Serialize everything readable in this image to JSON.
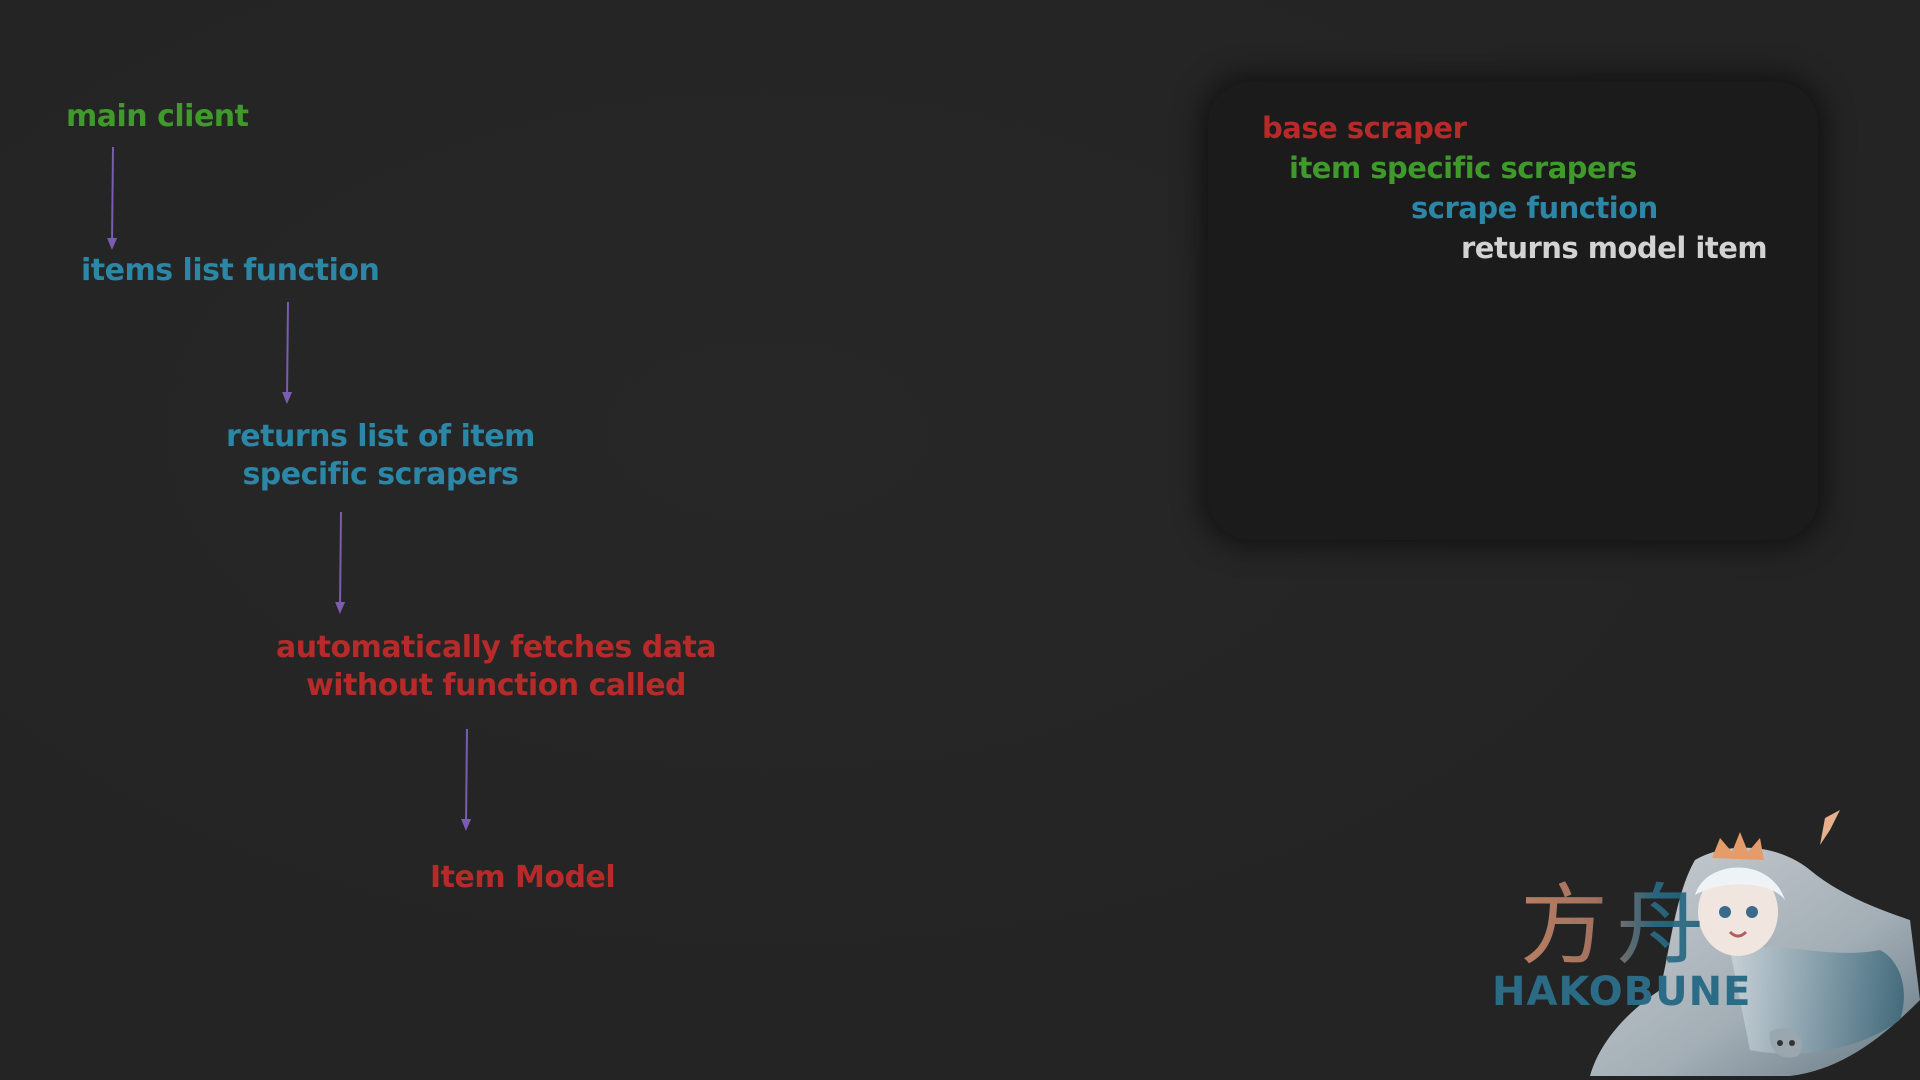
{
  "flow": {
    "main_client": "main client",
    "items_list_function": "items list function",
    "returns_list": [
      "returns list of item",
      "specific scrapers"
    ],
    "auto_fetch": [
      "automatically fetches data",
      "without function called"
    ],
    "item_model": "Item Model"
  },
  "legend": {
    "base_scraper": "base scraper",
    "item_specific_scrapers": "item specific scrapers",
    "scrape_function": "scrape function",
    "returns_model_item": "returns model item"
  },
  "brand": {
    "kanji": "方舟",
    "name": "HAKOBUNE"
  },
  "colors": {
    "background": "#252525",
    "legend_box": "#1b1b1b",
    "green": "#3f9a2b",
    "teal": "#2c86a6",
    "red": "#b72a2a",
    "white": "#d3d3d3",
    "arrow": "#7a5cb0"
  }
}
